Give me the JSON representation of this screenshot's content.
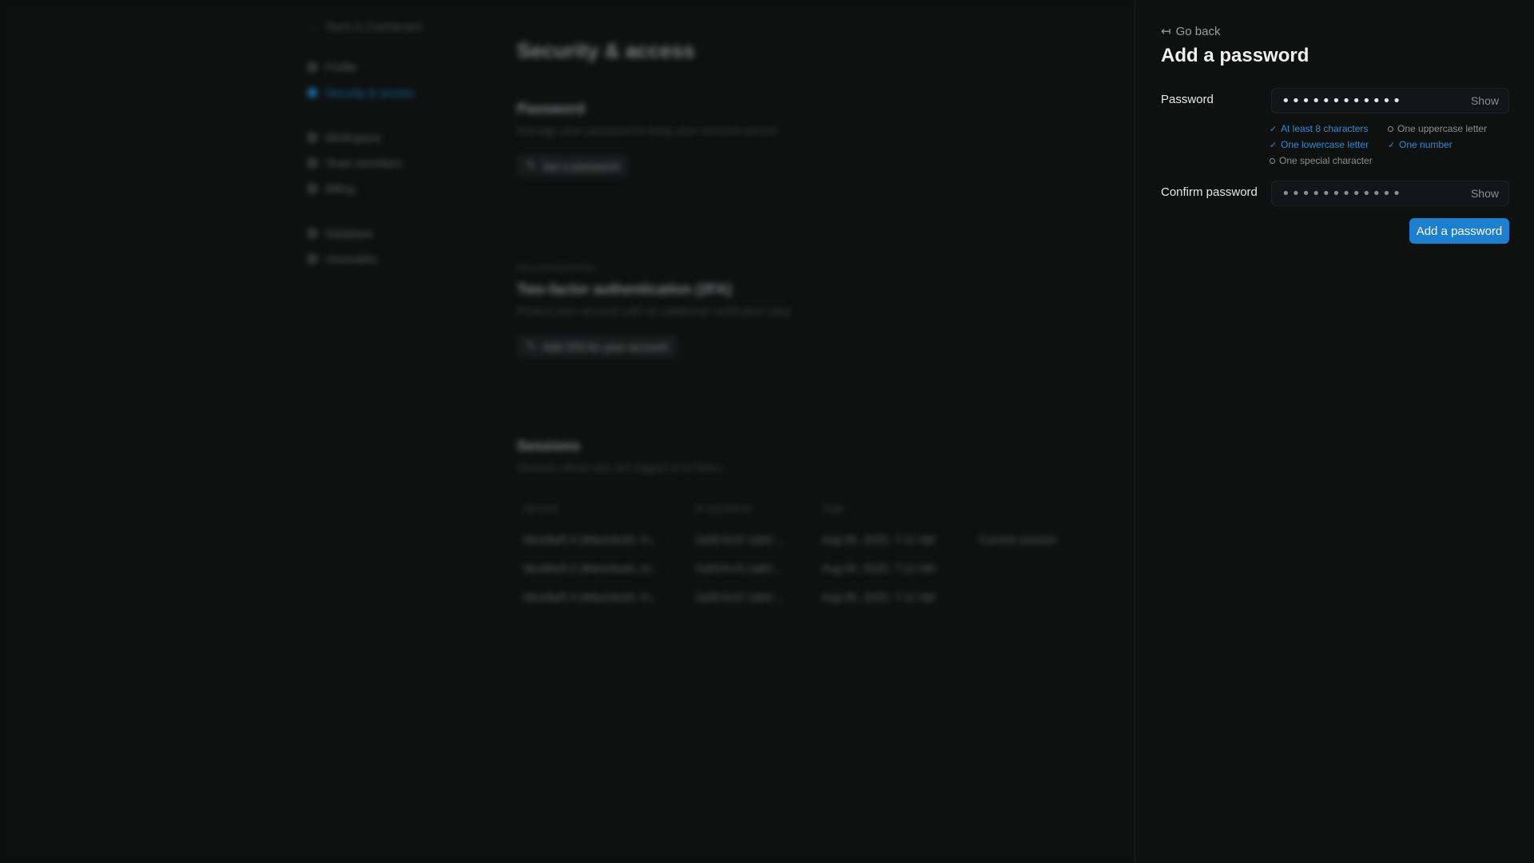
{
  "background": {
    "nav": {
      "back_label": "Back to Dashboard",
      "items_group1": [
        {
          "label": "Profile",
          "active": false
        },
        {
          "label": "Security & access",
          "active": true
        }
      ],
      "items_group2": [
        {
          "label": "Workspace"
        },
        {
          "label": "Team members"
        },
        {
          "label": "Billing"
        }
      ],
      "items_group3": [
        {
          "label": "Database"
        },
        {
          "label": "Anomalies"
        }
      ]
    },
    "main": {
      "title": "Security & access",
      "password_section": {
        "title": "Password",
        "subtitle": "Manage your password to keep your account secure.",
        "button": "Set a password"
      },
      "tfa_section": {
        "eyebrow": "RECOMMENDED",
        "title": "Two-factor authentication (2FA)",
        "subtitle": "Protect your account with an additional verification step.",
        "button": "Add 2FA for your account"
      },
      "sessions_section": {
        "title": "Sessions",
        "subtitle": "Devices where you are logged in to Retro.",
        "columns": [
          "DEVICE",
          "IP ADDRESS",
          "TIME",
          ""
        ],
        "rows": [
          [
            "Mozilla/5.0 (Macintosh; In...",
            "2a00:fcc0:1ab0:...",
            "Aug 05, 2025, 7:12 AM",
            "Current session"
          ],
          [
            "Mozilla/5.0 (Macintosh; In...",
            "2a00:fcc0:1ab0:...",
            "Aug 05, 2025, 7:12 AM",
            ""
          ],
          [
            "Mozilla/5.0 (Macintosh; In...",
            "2a00:fcc0:1ab0:...",
            "Aug 05, 2025, 7:12 AM",
            ""
          ]
        ]
      }
    }
  },
  "panel": {
    "go_back": "Go back",
    "title": "Add a password",
    "password": {
      "label": "Password",
      "value_masked": "••••••••••••",
      "show": "Show"
    },
    "requirements": [
      {
        "label": "At least 8 characters",
        "met": true
      },
      {
        "label": "One uppercase letter",
        "met": false
      },
      {
        "label": "One lowercase letter",
        "met": true
      },
      {
        "label": "One number",
        "met": true
      },
      {
        "label": "One special character",
        "met": false
      }
    ],
    "confirm": {
      "label": "Confirm password",
      "value_masked": "••••••••••••",
      "show": "Show"
    },
    "submit_label": "Add a password"
  },
  "colors": {
    "accent": "#1c7fd0",
    "requirement_met": "#2b8ad6",
    "background": "#0f1010"
  },
  "icons": {
    "go_back": "arrow-left-to-line-icon",
    "met": "check-icon",
    "unmet": "circle-icon"
  }
}
